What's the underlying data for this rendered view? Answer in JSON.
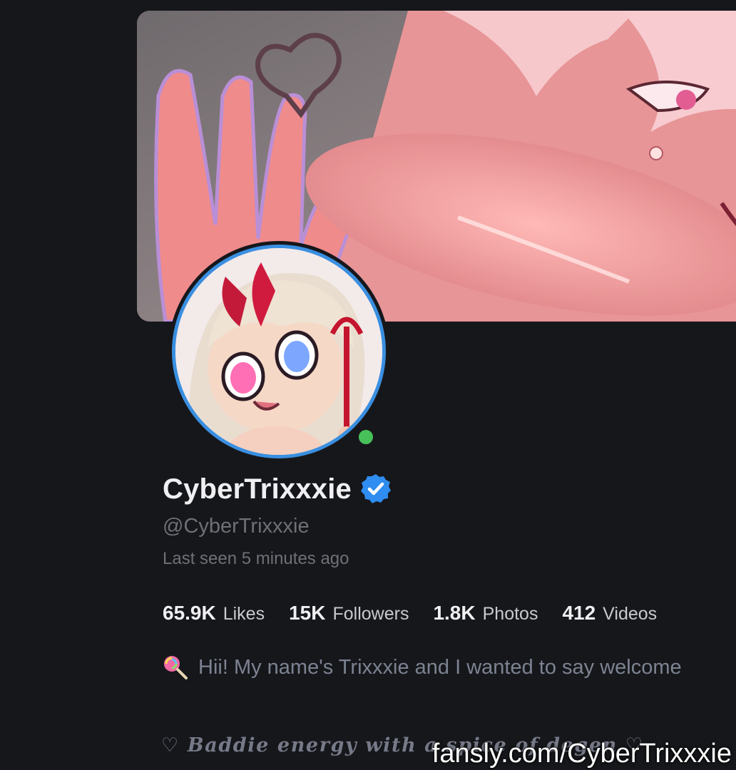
{
  "profile": {
    "display_name": "CyberTrixxxie",
    "handle": "@CyberTrixxxie",
    "last_seen": "Last seen 5 minutes ago",
    "verified": true,
    "online": true
  },
  "stats": [
    {
      "value": "65.9K",
      "label": "Likes"
    },
    {
      "value": "15K",
      "label": "Followers"
    },
    {
      "value": "1.8K",
      "label": "Photos"
    },
    {
      "value": "412",
      "label": "Videos"
    }
  ],
  "bio": {
    "icon": "lollipop-icon",
    "text": "Hii! My name's Trixxxie and I wanted to say welcome"
  },
  "tagline": "♡ Baddie energy with a spice of degen ♡",
  "watermark": "fansly.com/CyberTrixxxie",
  "colors": {
    "background": "#16171b",
    "avatar_ring": "#3a8fe0",
    "online": "#48c05a",
    "verified": "#2f8cf0",
    "muted_text": "#6e7077"
  },
  "icons": [
    "verified-badge-icon",
    "lollipop-icon",
    "heart-doodle-icon"
  ]
}
